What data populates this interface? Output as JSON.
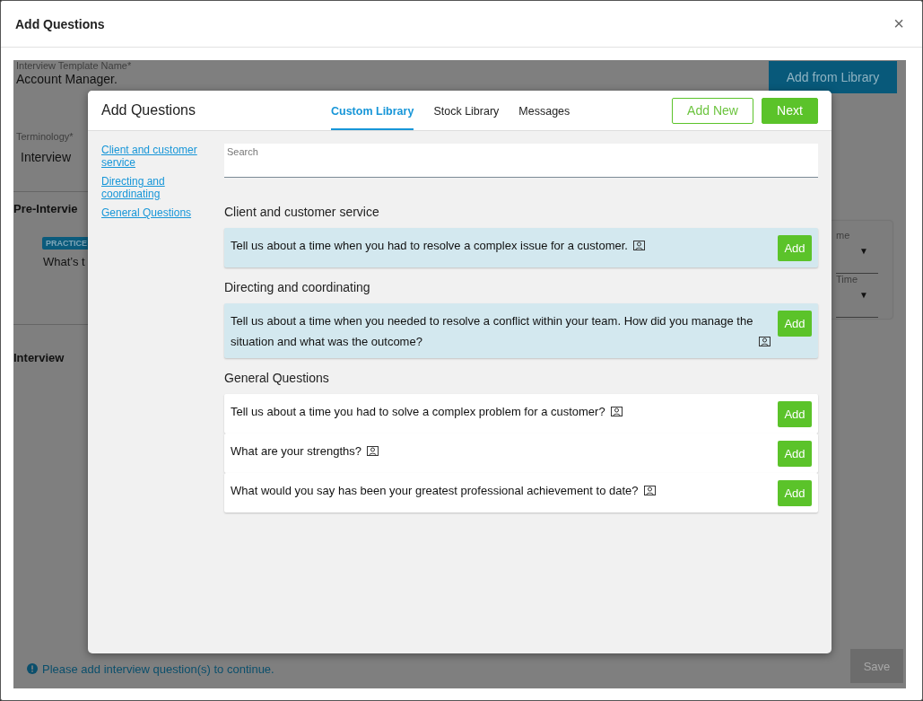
{
  "dialog": {
    "title": "Add Questions",
    "close": "×"
  },
  "background": {
    "template_name": {
      "label": "Interview Template Name*",
      "value": "Account Manager."
    },
    "add_from_library": "Add from Library",
    "terminology": {
      "label": "Terminology*",
      "value": "Interview"
    },
    "pre_interview_heading": "Pre-Intervie",
    "practice_badge": "PRACTICE",
    "question_preview": "What’s t",
    "side_card": [
      {
        "label": "me",
        "arrow": "▼"
      },
      {
        "label": "Time",
        "arrow": "▼"
      }
    ],
    "interview_heading": "Interview",
    "notice": "Please add interview question(s) to continue.",
    "save": {
      "label": "Save",
      "disabled": true
    }
  },
  "modal": {
    "title": "Add Questions",
    "tabs": [
      {
        "label": "Custom Library",
        "selected": true
      },
      {
        "label": "Stock Library",
        "selected": false
      },
      {
        "label": "Messages",
        "selected": false
      }
    ],
    "buttons": [
      {
        "label": "Add New",
        "kind": "outline"
      },
      {
        "label": "Next",
        "kind": "primary"
      }
    ],
    "search": {
      "placeholder": "Search"
    },
    "categories": [
      "Client and customer service",
      "Directing and coordinating",
      "General Questions"
    ],
    "sections": [
      {
        "heading": "Client and customer service",
        "questions": [
          {
            "text": "Tell us about a time when you had to resolve a complex issue for a customer.",
            "selected": true,
            "add": "Add"
          }
        ]
      },
      {
        "heading": "Directing and coordinating",
        "questions": [
          {
            "text": "Tell us about a time when you needed to resolve a conflict within your team. How did you manage the situation and what was the outcome?",
            "selected": true,
            "add": "Add"
          }
        ]
      },
      {
        "heading": "General Questions",
        "questions": [
          {
            "text": "Tell us about a time you had to solve a complex problem for a customer?",
            "selected": false,
            "add": "Add"
          },
          {
            "text": "What are your strengths?",
            "selected": false,
            "add": "Add"
          },
          {
            "text": "What would you say has been your greatest professional achievement to date?",
            "selected": false,
            "add": "Add"
          }
        ]
      }
    ]
  }
}
